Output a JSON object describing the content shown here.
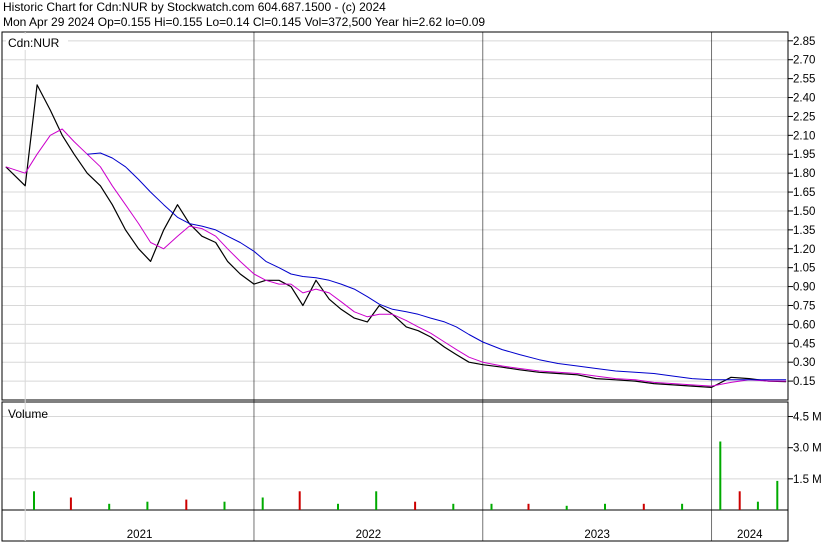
{
  "header": {
    "line1": "Historic Chart for Cdn:NUR by Stockwatch.com 604.687.1500 - (c) 2024",
    "line2": "Mon Apr 29 2024   Op=0.155   Hi=0.155   Lo=0.14   Cl=0.145   Vol=372,500   Year hi=2.62   lo=0.09"
  },
  "colors": {
    "price": "#000000",
    "ma_short": "#cc00cc",
    "ma_long": "#0000cc",
    "vol_up": "#00aa00",
    "vol_down": "#cc0000",
    "grid": "#d8d8d8"
  },
  "chart_data": [
    {
      "type": "line",
      "panel": "price",
      "legend": "Cdn:NUR",
      "ylim": [
        0.0,
        2.92
      ],
      "ytick_labels": [
        "2.85",
        "2.70",
        "2.55",
        "2.40",
        "2.25",
        "2.10",
        "1.95",
        "1.80",
        "1.65",
        "1.50",
        "1.35",
        "1.20",
        "1.05",
        "0.90",
        "0.75",
        "0.60",
        "0.45",
        "0.30",
        "0.15"
      ],
      "ytick_values": [
        2.85,
        2.7,
        2.55,
        2.4,
        2.25,
        2.1,
        1.95,
        1.8,
        1.65,
        1.5,
        1.35,
        1.2,
        1.05,
        0.9,
        0.75,
        0.6,
        0.45,
        0.3,
        0.15
      ],
      "x": [
        "2020-12-01",
        "2021-01-01",
        "2021-01-20",
        "2021-02-10",
        "2021-03-01",
        "2021-03-20",
        "2021-04-10",
        "2021-05-01",
        "2021-05-20",
        "2021-06-10",
        "2021-07-01",
        "2021-07-20",
        "2021-08-10",
        "2021-09-01",
        "2021-09-20",
        "2021-10-10",
        "2021-11-01",
        "2021-11-20",
        "2021-12-10",
        "2022-01-01",
        "2022-01-20",
        "2022-02-10",
        "2022-03-01",
        "2022-03-20",
        "2022-04-10",
        "2022-05-01",
        "2022-05-20",
        "2022-06-10",
        "2022-07-01",
        "2022-07-20",
        "2022-08-10",
        "2022-09-01",
        "2022-09-20",
        "2022-10-10",
        "2022-11-01",
        "2022-11-20",
        "2022-12-10",
        "2023-01-01",
        "2023-02-01",
        "2023-03-01",
        "2023-04-01",
        "2023-05-01",
        "2023-06-01",
        "2023-07-01",
        "2023-08-01",
        "2023-09-01",
        "2023-10-01",
        "2023-11-01",
        "2023-12-01",
        "2024-01-01",
        "2024-02-01",
        "2024-03-01",
        "2024-04-01",
        "2024-04-29"
      ],
      "series": [
        {
          "values": [
            1.85,
            1.7,
            2.5,
            2.3,
            2.1,
            1.95,
            1.8,
            1.7,
            1.55,
            1.35,
            1.2,
            1.1,
            1.35,
            1.55,
            1.4,
            1.3,
            1.25,
            1.1,
            1.0,
            0.92,
            0.95,
            0.95,
            0.9,
            0.75,
            0.95,
            0.8,
            0.72,
            0.65,
            0.62,
            0.75,
            0.68,
            0.58,
            0.55,
            0.5,
            0.42,
            0.36,
            0.3,
            0.28,
            0.26,
            0.24,
            0.22,
            0.21,
            0.2,
            0.17,
            0.16,
            0.15,
            0.13,
            0.12,
            0.11,
            0.1,
            0.18,
            0.17,
            0.15,
            0.145
          ]
        },
        {
          "values": [
            1.85,
            1.8,
            1.95,
            2.1,
            2.15,
            2.05,
            1.95,
            1.85,
            1.7,
            1.55,
            1.4,
            1.25,
            1.2,
            1.3,
            1.38,
            1.36,
            1.3,
            1.2,
            1.1,
            1.0,
            0.95,
            0.92,
            0.92,
            0.85,
            0.88,
            0.85,
            0.78,
            0.7,
            0.66,
            0.68,
            0.68,
            0.63,
            0.58,
            0.53,
            0.46,
            0.4,
            0.34,
            0.3,
            0.27,
            0.25,
            0.23,
            0.22,
            0.21,
            0.19,
            0.17,
            0.16,
            0.14,
            0.13,
            0.12,
            0.11,
            0.14,
            0.16,
            0.15,
            0.15
          ]
        },
        {
          "values": [
            null,
            null,
            null,
            null,
            null,
            null,
            1.95,
            1.96,
            1.92,
            1.85,
            1.75,
            1.65,
            1.55,
            1.45,
            1.4,
            1.38,
            1.35,
            1.3,
            1.25,
            1.18,
            1.1,
            1.05,
            1.0,
            0.98,
            0.97,
            0.95,
            0.92,
            0.88,
            0.82,
            0.76,
            0.72,
            0.7,
            0.68,
            0.65,
            0.62,
            0.58,
            0.52,
            0.46,
            0.4,
            0.36,
            0.32,
            0.29,
            0.27,
            0.25,
            0.23,
            0.22,
            0.21,
            0.19,
            0.17,
            0.16,
            0.16,
            0.16,
            0.16,
            0.16
          ]
        }
      ]
    },
    {
      "type": "bar",
      "panel": "volume",
      "title": "Volume",
      "ylim": [
        0,
        5.2
      ],
      "ytick_labels": [
        "4.5 M",
        "3.0 M",
        "1.5 M"
      ],
      "ytick_values": [
        4.5,
        3.0,
        1.5
      ],
      "xtick_labels": [
        "2021",
        "2022",
        "2023",
        "2024"
      ],
      "x": [
        "2021-01",
        "2021-03",
        "2021-05",
        "2021-07",
        "2021-09",
        "2021-11",
        "2022-01",
        "2022-03",
        "2022-05",
        "2022-07",
        "2022-09",
        "2022-11",
        "2023-01",
        "2023-03",
        "2023-05",
        "2023-07",
        "2023-09",
        "2023-11",
        "2024-01",
        "2024-02",
        "2024-03",
        "2024-04"
      ],
      "values": [
        0.9,
        0.6,
        0.3,
        0.4,
        0.5,
        0.4,
        0.6,
        0.9,
        0.3,
        0.9,
        0.4,
        0.3,
        0.3,
        0.3,
        0.2,
        0.3,
        0.3,
        0.3,
        3.3,
        0.9,
        0.4,
        1.4
      ]
    }
  ]
}
